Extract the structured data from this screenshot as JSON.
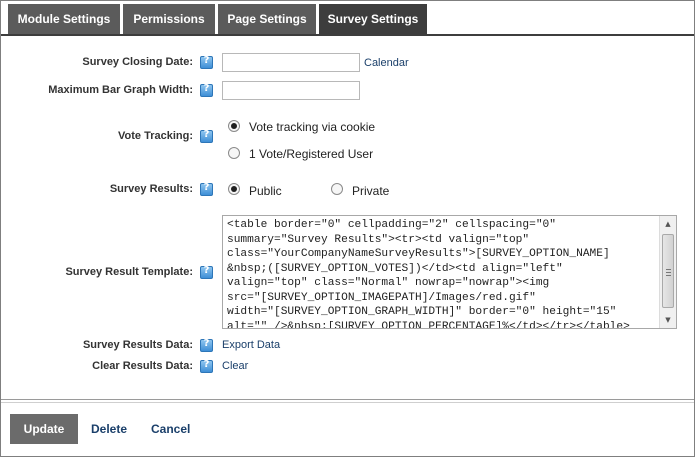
{
  "tabs": [
    {
      "label": "Module Settings",
      "active": false
    },
    {
      "label": "Permissions",
      "active": false
    },
    {
      "label": "Page Settings",
      "active": false
    },
    {
      "label": "Survey Settings",
      "active": true
    }
  ],
  "form": {
    "closing_date_label": "Survey Closing Date:",
    "closing_date_value": "",
    "calendar_link": "Calendar",
    "max_bar_label": "Maximum Bar Graph Width:",
    "max_bar_value": "",
    "vote_tracking_label": "Vote Tracking:",
    "vote_tracking_options": [
      {
        "label": "Vote tracking via cookie",
        "checked": true
      },
      {
        "label": "1 Vote/Registered User",
        "checked": false
      }
    ],
    "results_label": "Survey Results:",
    "results_options": [
      {
        "label": "Public",
        "checked": true
      },
      {
        "label": "Private",
        "checked": false
      }
    ],
    "template_label": "Survey Result Template:",
    "template_value": "<table border=\"0\" cellpadding=\"2\" cellspacing=\"0\"\nsummary=\"Survey Results\"><tr><td valign=\"top\"\nclass=\"YourCompanyNameSurveyResults\">[SURVEY_OPTION_NAME]\n&nbsp;([SURVEY_OPTION_VOTES])</td><td align=\"left\"\nvalign=\"top\" class=\"Normal\" nowrap=\"nowrap\"><img\nsrc=\"[SURVEY_OPTION_IMAGEPATH]/Images/red.gif\"\nwidth=\"[SURVEY_OPTION_GRAPH_WIDTH]\" border=\"0\" height=\"15\"\nalt=\"\" />&nbsp;[SURVEY_OPTION_PERCENTAGE]%</td></tr></table>",
    "results_data_label": "Survey Results Data:",
    "export_link": "Export Data",
    "clear_label": "Clear Results Data:",
    "clear_link": "Clear"
  },
  "actions": {
    "update": "Update",
    "delete": "Delete",
    "cancel": "Cancel"
  }
}
